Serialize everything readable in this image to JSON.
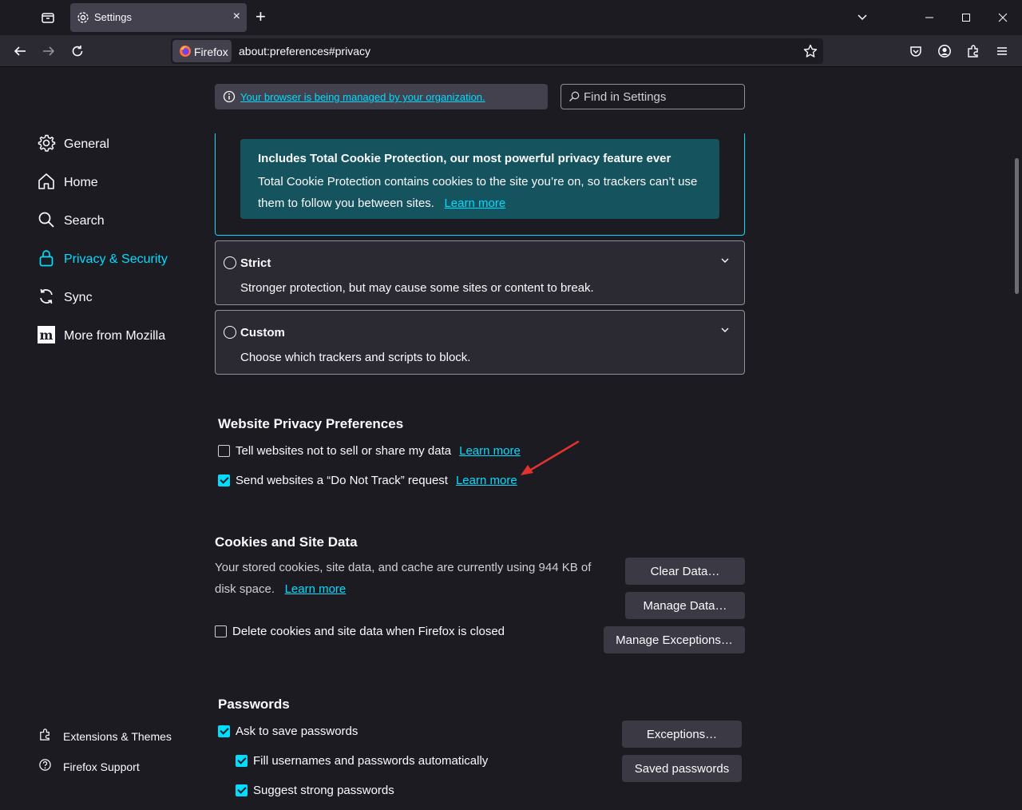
{
  "tab": {
    "title": "Settings",
    "close": "×",
    "new_tab": "+"
  },
  "navbar": {
    "identity_label": "Firefox",
    "url": "about:preferences#privacy"
  },
  "managed_notice": {
    "link": "Your browser is being managed by your organization."
  },
  "search": {
    "placeholder": "Find in Settings"
  },
  "sidebar": {
    "items": [
      {
        "label": "General",
        "icon": "gear-icon"
      },
      {
        "label": "Home",
        "icon": "home-icon"
      },
      {
        "label": "Search",
        "icon": "search-icon"
      },
      {
        "label": "Privacy & Security",
        "icon": "lock-icon",
        "active": true
      },
      {
        "label": "Sync",
        "icon": "sync-icon"
      },
      {
        "label": "More from Mozilla",
        "icon": "mozilla-icon"
      }
    ],
    "footer": [
      {
        "label": "Extensions & Themes",
        "icon": "puzzle-icon"
      },
      {
        "label": "Firefox Support",
        "icon": "help-icon"
      }
    ]
  },
  "standard_card": {
    "tcp_title": "Includes Total Cookie Protection, our most powerful privacy feature ever",
    "tcp_desc": "Total Cookie Protection contains cookies to the site you’re on, so trackers can’t use them to follow you between sites.",
    "tcp_link": "Learn more"
  },
  "strict": {
    "title": "Strict",
    "desc": "Stronger protection, but may cause some sites or content to break."
  },
  "custom": {
    "title": "Custom",
    "desc": "Choose which trackers and scripts to block."
  },
  "website_privacy": {
    "heading": "Website Privacy Preferences",
    "sell_label": "Tell websites not to sell or share my data",
    "sell_checked": false,
    "dnt_label": "Send websites a “Do Not Track” request",
    "dnt_checked": true,
    "learn_more": "Learn more"
  },
  "cookies": {
    "heading": "Cookies and Site Data",
    "desc": "Your stored cookies, site data, and cache are currently using 944 KB of disk space.",
    "learn_more": "Learn more",
    "clear_button": "Clear Data…",
    "manage_button": "Manage Data…",
    "exceptions_button": "Manage Exceptions…",
    "delete_label": "Delete cookies and site data when Firefox is closed",
    "delete_checked": false
  },
  "passwords": {
    "heading": "Passwords",
    "ask_label": "Ask to save passwords",
    "fill_label": "Fill usernames and passwords automatically",
    "suggest_label": "Suggest strong passwords",
    "exceptions_button": "Exceptions…",
    "saved_button": "Saved passwords"
  },
  "colors": {
    "accent": "#00ddff",
    "background": "#1c1b22",
    "annotation_arrow": "#e0332e"
  }
}
